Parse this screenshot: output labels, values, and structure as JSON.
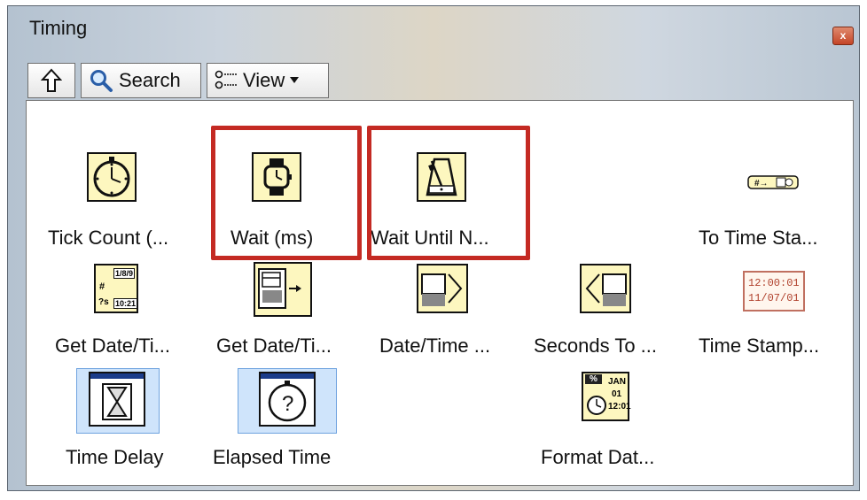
{
  "window": {
    "title": "Timing",
    "close_label": "x"
  },
  "toolbar": {
    "search_label": "Search",
    "view_label": "View"
  },
  "palette": {
    "items": [
      {
        "label": "Tick Count (...",
        "icon": "stopwatch-icon"
      },
      {
        "label": "Wait (ms)",
        "icon": "wristwatch-icon"
      },
      {
        "label": "Wait Until N...",
        "icon": "metronome-icon"
      },
      {
        "label": "To Time Sta...",
        "icon": "to-timestamp-icon"
      },
      {
        "label": "Get Date/Ti...",
        "icon": "get-date-time-string-icon"
      },
      {
        "label": "Get Date/Ti...",
        "icon": "get-date-time-seconds-icon"
      },
      {
        "label": "Date/Time ...",
        "icon": "date-time-to-seconds-icon"
      },
      {
        "label": "Seconds To ...",
        "icon": "seconds-to-date-time-icon"
      },
      {
        "label": "Time Stamp...",
        "icon": "timestamp-constant-icon"
      },
      {
        "label": "Time Delay",
        "icon": "hourglass-icon"
      },
      {
        "label": "Elapsed Time",
        "icon": "elapsed-time-icon"
      },
      {
        "label": "Format Dat...",
        "icon": "format-date-time-icon"
      }
    ],
    "timestamp_constant": {
      "time": "12:00:01",
      "date": "11/07/01"
    },
    "format_icon_text": {
      "pct": "%",
      "month": "JAN",
      "day": "01",
      "time": "12:01"
    },
    "get_date_icon_text": {
      "date": "1/8/9",
      "time": "10:21",
      "q": "?s"
    }
  },
  "colors": {
    "highlight": "#c42a23",
    "icon_fill": "#fdf7bf",
    "selection_bg": "#cfe4fb"
  }
}
